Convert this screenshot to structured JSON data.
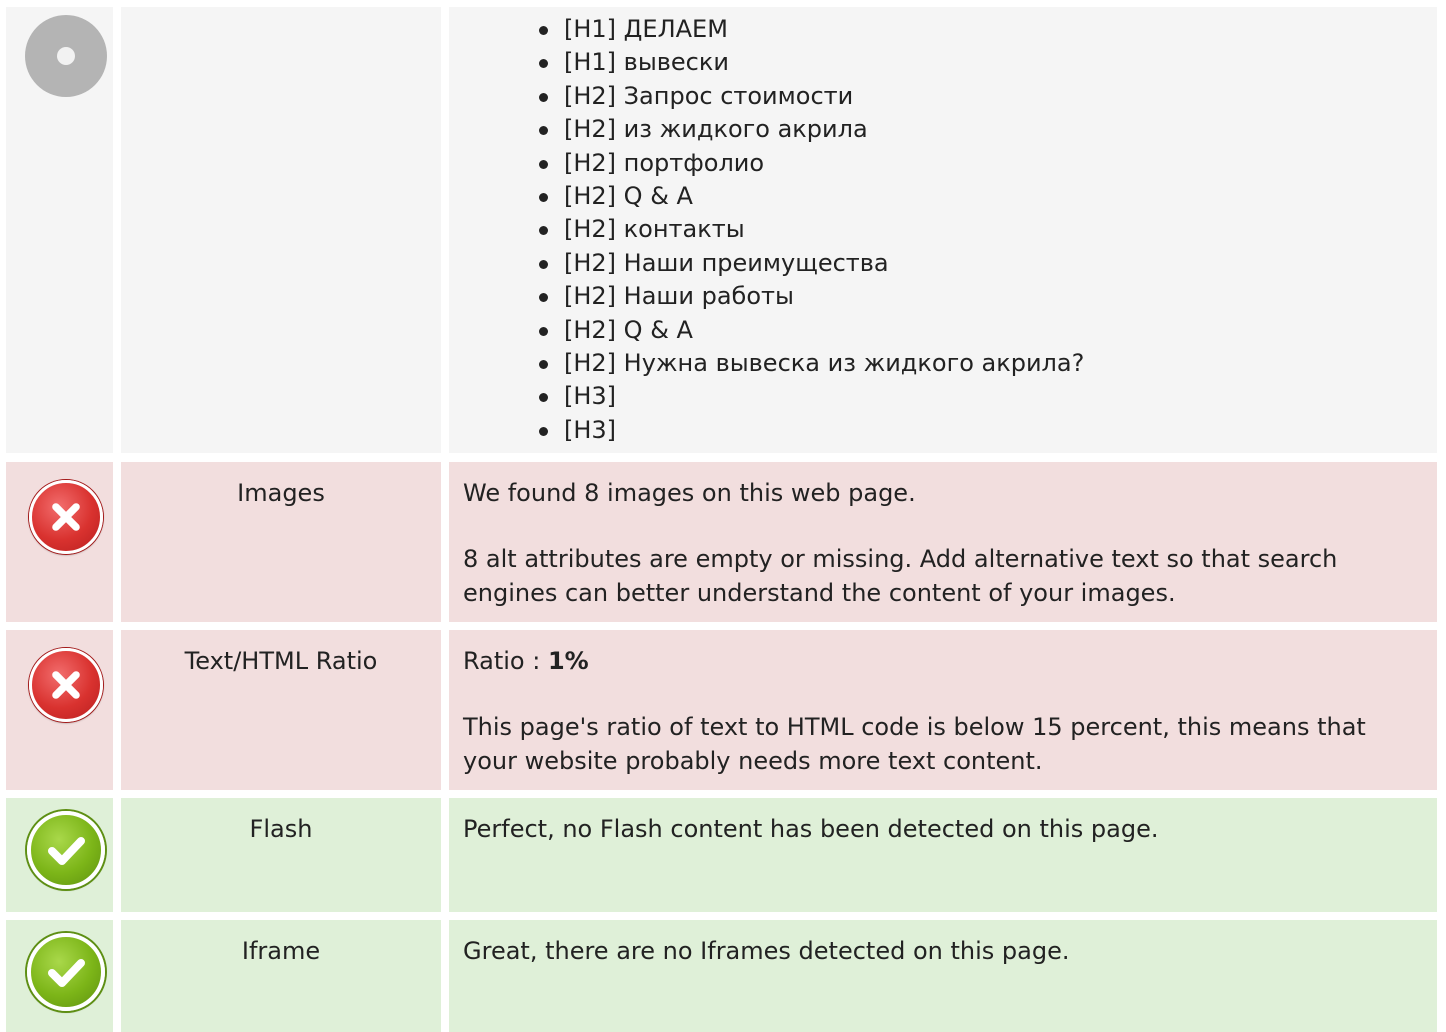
{
  "headings": {
    "items": [
      "[H1] ДЕЛАЕМ",
      "[H1] вывески",
      "[H2] Запрос стоимости",
      "[H2] из жидкого акрила",
      "[H2] портфолио",
      "[H2] Q & A",
      "[H2] контакты",
      "[H2] Наши преимущества",
      "[H2] Наши работы",
      "[H2] Q & A",
      "[H2] Нужна вывеска из жидкого акрила?",
      "[H3]",
      "[H3]"
    ]
  },
  "images": {
    "label": "Images",
    "status": "error",
    "line1": "We found 8 images on this web page.",
    "line2": "8 alt attributes are empty or missing. Add alternative text so that search engines can better understand the content of your images."
  },
  "ratio": {
    "label": "Text/HTML Ratio",
    "status": "error",
    "ratio_prefix": "Ratio : ",
    "ratio_value": "1%",
    "line2": "This page's ratio of text to HTML code is below 15 percent, this means that your website probably needs more text content."
  },
  "flash": {
    "label": "Flash",
    "status": "ok",
    "line1": "Perfect, no Flash content has been detected on this page."
  },
  "iframe": {
    "label": "Iframe",
    "status": "ok",
    "line1": "Great, there are no Iframes detected on this page."
  },
  "colors": {
    "error_bg": "#f2dede",
    "ok_bg": "#dff0d8",
    "neutral_bg": "#f5f5f5",
    "error_icon": "#d9322f",
    "ok_icon": "#7cb518"
  },
  "icons": {
    "neutral": "info-neutral-icon",
    "error": "error-x-icon",
    "ok": "checkmark-icon"
  }
}
